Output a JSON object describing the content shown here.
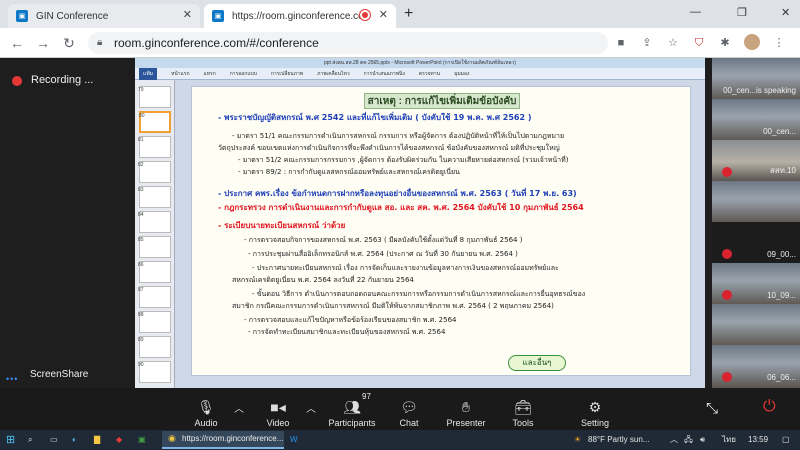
{
  "browser": {
    "tabs": [
      {
        "title": "GIN Conference",
        "active": false
      },
      {
        "title": "https://room.ginconference.com/#/en",
        "active": true
      }
    ],
    "new_tab_symbol": "+",
    "address": "room.ginconference.com/#/conference",
    "window_controls": [
      "—",
      "❐",
      "✕"
    ]
  },
  "meeting": {
    "recording_label": "Recording ...",
    "screenshare_label": "ScreenShare",
    "fullscreen_icon": "fullscreen-icon"
  },
  "presentation": {
    "window_title": "ppt ส่งสม.สส.28 ตค 2565.pptx - Microsoft PowerPoint (การเปิดใช้งานผลิตภัณฑ์ล้มเหลว)",
    "ribbon_tabs": [
      "แฟ้ม",
      "หน้าแรก",
      "แทรก",
      "การออกแบบ",
      "การเปลี่ยนภาพ",
      "ภาพเคลื่อนไหว",
      "การนำเสนอภาพนิ่ง",
      "ตรวจทาน",
      "มุมมอง"
    ],
    "slide_numbers": [
      "79",
      "80",
      "81",
      "82",
      "83",
      "84",
      "85",
      "86",
      "87",
      "88",
      "89",
      "90"
    ],
    "slide": {
      "heading": "สาเหตุ : การแก้ไขเพิ่มเติมข้อบังคับ",
      "lines": [
        {
          "text": "-  พระราชบัญญัติสหกรณ์ พ.ศ 2542 และที่แก้ไขเพิ่มเติม ( บังคับใช้ 19 พ.ค. พ.ศ 2562 )",
          "tone": "blue"
        },
        {
          "text": "- มาตรา 51/1 คณะกรรมการดำเนินการสหกรณ์ กรรมการ หรือผู้จัดการ ต้องปฏิบัติหน้าที่ให้เป็นไปตามกฎหมาย",
          "tone": "dark"
        },
        {
          "text": "วัตถุประสงค์ ขอบเขตแห่งการดำเนินกิจการที่จะพึงดำเนินการได้ของสหกรณ์ ข้อบังคับของสหกรณ์ มติที่ประชุมใหญ่",
          "tone": "dark"
        },
        {
          "text": "- มาตรา 51/2 คณะกรรมการกรรมการ ,ผู้จัดการ ต้องรับผิดร่วมกัน ในความเสียหายต่อสหกรณ์ (รวมเจ้าหน้าที่)",
          "tone": "dark"
        },
        {
          "text": "- มาตรา 89/2 : การกำกับดูแลสหกรณ์ออมทรัพย์และสหกรณ์เครดิตยูเนี่ยน",
          "tone": "dark"
        },
        {
          "text": "-  ประกาศ คพร.เรื่อง ข้อกำหนดการฝากหรือลงทุนอย่างอื่นของสหกรณ์ พ.ศ. 2563 ( วันที่ 17 พ.ย. 63)",
          "tone": "blue"
        },
        {
          "text": "-  กฎกระทรวง การดำเนินงานและการกำกับดูแล สอ. และ สค. พ.ศ. 2564 บังคับใช้ 10 กุมภาพันธ์ 2564",
          "tone": "red"
        },
        {
          "text": "-  ระเบียบนายทะเบียนสหกรณ์ ว่าด้วย",
          "tone": "red"
        },
        {
          "text": "- การตรวจสอบกิจการของสหกรณ์ พ.ศ. 2563 ( มีผลบังคับใช้ตั้งแต่วันที่ 8 กุมภาพันธ์ 2564 )",
          "tone": "dark"
        },
        {
          "text": "- การประชุมผ่านสื่ออิเล็กทรอนิกส์ พ.ศ. 2564 (ประกาศ ณ วันที่ 30 กันยายน พ.ศ. 2564 )",
          "tone": "dark"
        },
        {
          "text": "- ประกาศนายทะเบียนสหกรณ์ เรื่อง การจัดเก็บและรายงานข้อมูลทางการเงินของสหกรณ์ออมทรัพย์และ",
          "tone": "dark"
        },
        {
          "text": "สหกรณ์เครดิตยูเนี่ยน พ.ศ. 2564 ลงวันที่ 22 กันยายน 2564",
          "tone": "dark"
        },
        {
          "text": "- ขั้นตอน วิธีการ ดำเนินการตอบถอดถอนคณะกรรมการหรือกรรมการดำเนินการสหกรณ์และการยื่นอุทธรณ์ของ",
          "tone": "dark"
        },
        {
          "text": "สมาชิก กรณีคณะกรรมการดำเนินการสหกรณ์ มีมติให้พ้นจากสมาชิกภาพ พ.ศ. 2564 ( 2 พฤษภาคม 2564)",
          "tone": "dark"
        },
        {
          "text": "- การตรวจสอบและแก้ไขปัญหาหรือข้อร้องเรียนของสมาชิก พ.ศ. 2564",
          "tone": "dark"
        },
        {
          "text": "- การจัดทำทะเบียนสมาชิกและทะเบียนหุ้นของสหกรณ์ พ.ศ. 2564",
          "tone": "dark"
        }
      ],
      "more_button": "และอื่นๆ"
    }
  },
  "participants": {
    "tiles": [
      {
        "name": "00_cen...is speaking",
        "kind": "room",
        "muted": false
      },
      {
        "name": "00_cen...",
        "kind": "room",
        "muted": false
      },
      {
        "name": "สสท.10",
        "kind": "person",
        "muted": true
      },
      {
        "name": "",
        "kind": "room",
        "muted": false
      },
      {
        "name": "09_00...",
        "kind": "dark",
        "muted": true
      },
      {
        "name": "10_09...",
        "kind": "room",
        "muted": true
      },
      {
        "name": "",
        "kind": "room",
        "muted": false
      },
      {
        "name": "06_06...",
        "kind": "room",
        "muted": true
      }
    ]
  },
  "toolbar": {
    "audio": "Audio",
    "video": "Video",
    "participants": "Participants",
    "participants_count": "97",
    "chat": "Chat",
    "presenter": "Presenter",
    "tools": "Tools",
    "setting": "Setting"
  },
  "taskbar": {
    "browser_item": "https://room.ginconference...",
    "weather": "88°F  Partly sun...",
    "language": "ไทย",
    "time": "13:59"
  },
  "colors": {
    "record_dot": "#e53935",
    "end_call": "#e53935",
    "slide_red": "#e0141e",
    "slide_blue": "#1e3fb5"
  }
}
